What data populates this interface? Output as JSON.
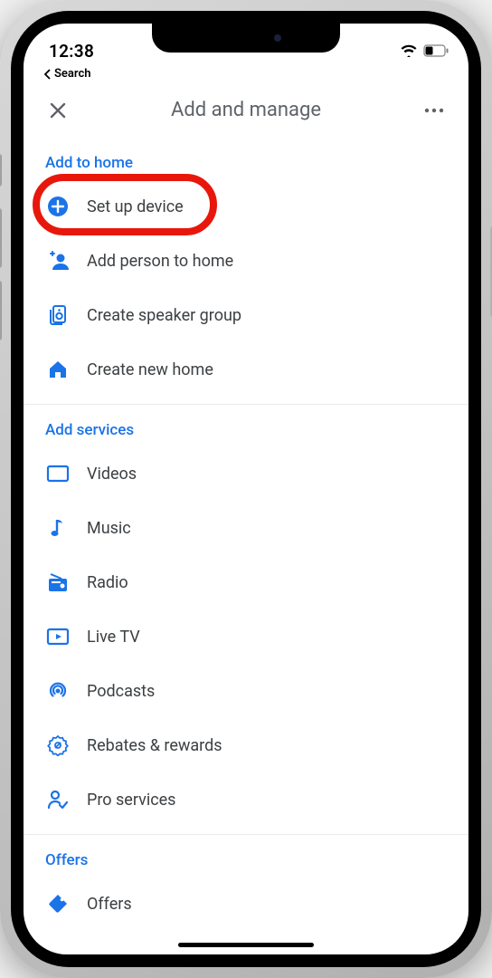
{
  "status": {
    "time": "12:38",
    "back_label": "Search"
  },
  "header": {
    "title": "Add and manage"
  },
  "sections": {
    "add_home": {
      "title": "Add to home",
      "items": [
        {
          "label": "Set up device"
        },
        {
          "label": "Add person to home"
        },
        {
          "label": "Create speaker group"
        },
        {
          "label": "Create new home"
        }
      ]
    },
    "add_services": {
      "title": "Add services",
      "items": [
        {
          "label": "Videos"
        },
        {
          "label": "Music"
        },
        {
          "label": "Radio"
        },
        {
          "label": "Live TV"
        },
        {
          "label": "Podcasts"
        },
        {
          "label": "Rebates & rewards"
        },
        {
          "label": "Pro services"
        }
      ]
    },
    "offers": {
      "title": "Offers",
      "items": [
        {
          "label": "Offers"
        }
      ]
    }
  },
  "annotation": {
    "highlighted_item": "Set up device"
  }
}
